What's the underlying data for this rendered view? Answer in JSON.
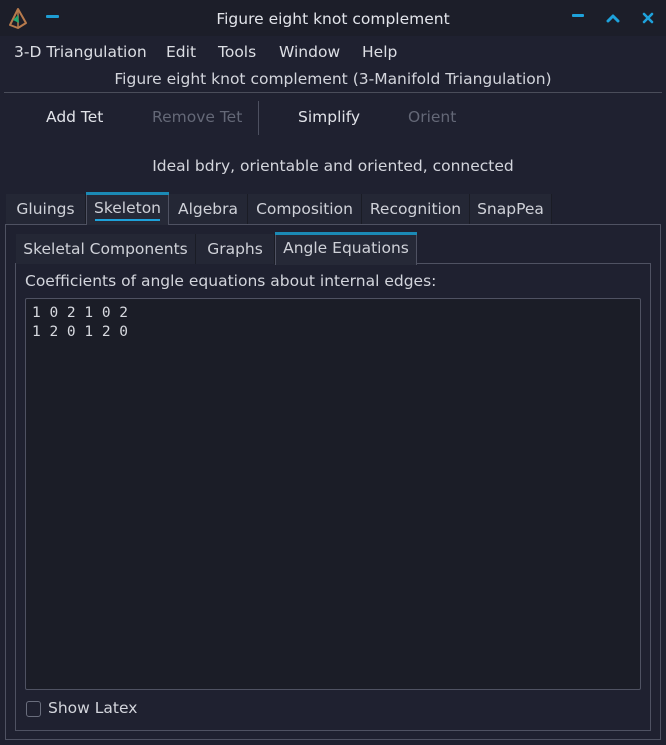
{
  "window": {
    "title": "Figure eight knot complement",
    "controls": {
      "minimize": "minimize",
      "maximize": "maximize",
      "close": "close"
    },
    "accent_color": "#1ea2db"
  },
  "menubar": {
    "items": [
      {
        "label": "3-D Triangulation"
      },
      {
        "label": "Edit"
      },
      {
        "label": "Tools"
      },
      {
        "label": "Window"
      },
      {
        "label": "Help"
      }
    ]
  },
  "subtitle": "Figure eight knot complement (3-Manifold Triangulation)",
  "toolbar": {
    "add_tet": "Add Tet",
    "remove_tet": "Remove Tet",
    "simplify": "Simplify",
    "orient": "Orient"
  },
  "status": "Ideal bdry, orientable and oriented, connected",
  "outer_tabs": [
    {
      "label": "Gluings",
      "active": false
    },
    {
      "label": "Skeleton",
      "active": true
    },
    {
      "label": "Algebra",
      "active": false
    },
    {
      "label": "Composition",
      "active": false
    },
    {
      "label": "Recognition",
      "active": false
    },
    {
      "label": "SnapPea",
      "active": false
    }
  ],
  "inner_tabs": [
    {
      "label": "Skeletal Components",
      "active": false
    },
    {
      "label": "Graphs",
      "active": false
    },
    {
      "label": "Angle Equations",
      "active": true
    }
  ],
  "angle_equations": {
    "label": "Coefficients of angle equations about internal edges:",
    "rows": [
      "1 0 2 1 0 2",
      "1 2 0 1 2 0"
    ],
    "text": "1 0 2 1 0 2\n1 2 0 1 2 0"
  },
  "show_latex": {
    "label": "Show Latex",
    "checked": false
  }
}
